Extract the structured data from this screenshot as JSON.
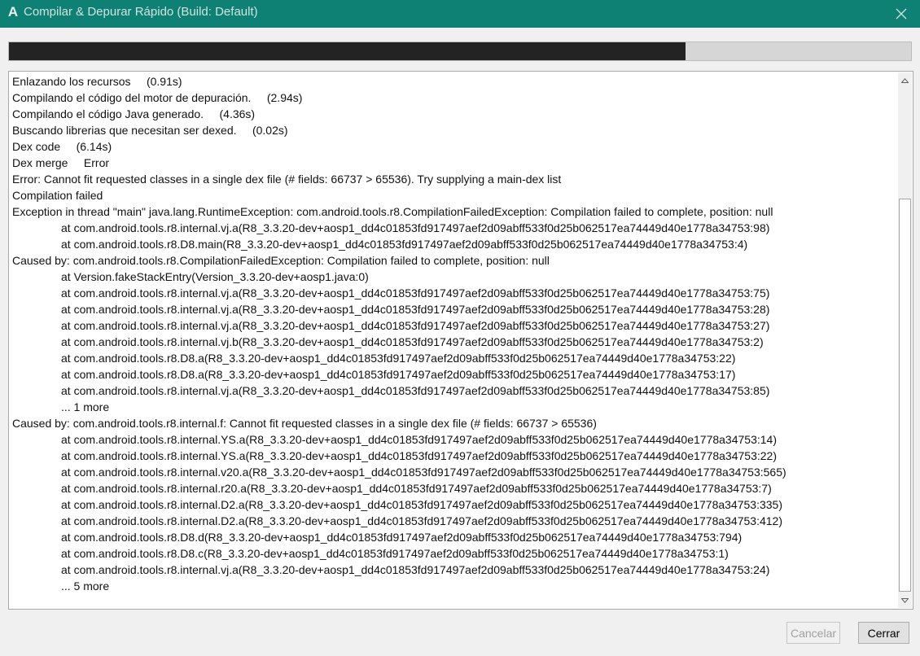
{
  "window": {
    "title": "Compilar & Depurar Rápido (Build: Default)",
    "app_icon_glyph": "A",
    "titlebar_color": "#0f8074",
    "close_icon": "close-icon"
  },
  "progress": {
    "value": 0.75
  },
  "log": {
    "lines": [
      {
        "text": "Enlazando los recursos     (0.91s)",
        "indent": false
      },
      {
        "text": "Compilando el código del motor de depuración.     (2.94s)",
        "indent": false
      },
      {
        "text": "Compilando el código Java generado.     (4.36s)",
        "indent": false
      },
      {
        "text": "Buscando librerias que necesitan ser dexed.     (0.02s)",
        "indent": false
      },
      {
        "text": "Dex code     (6.14s)",
        "indent": false
      },
      {
        "text": "Dex merge     Error",
        "indent": false
      },
      {
        "text": "Error: Cannot fit requested classes in a single dex file (# fields: 66737 > 65536). Try supplying a main-dex list",
        "indent": false
      },
      {
        "text": "Compilation failed",
        "indent": false
      },
      {
        "text": "Exception in thread \"main\" java.lang.RuntimeException: com.android.tools.r8.CompilationFailedException: Compilation failed to complete, position: null",
        "indent": false
      },
      {
        "text": "at com.android.tools.r8.internal.vj.a(R8_3.3.20-dev+aosp1_dd4c01853fd917497aef2d09abff533f0d25b062517ea74449d40e1778a34753:98)",
        "indent": true
      },
      {
        "text": "at com.android.tools.r8.D8.main(R8_3.3.20-dev+aosp1_dd4c01853fd917497aef2d09abff533f0d25b062517ea74449d40e1778a34753:4)",
        "indent": true
      },
      {
        "text": "Caused by: com.android.tools.r8.CompilationFailedException: Compilation failed to complete, position: null",
        "indent": false
      },
      {
        "text": "at Version.fakeStackEntry(Version_3.3.20-dev+aosp1.java:0)",
        "indent": true
      },
      {
        "text": "at com.android.tools.r8.internal.vj.a(R8_3.3.20-dev+aosp1_dd4c01853fd917497aef2d09abff533f0d25b062517ea74449d40e1778a34753:75)",
        "indent": true
      },
      {
        "text": "at com.android.tools.r8.internal.vj.a(R8_3.3.20-dev+aosp1_dd4c01853fd917497aef2d09abff533f0d25b062517ea74449d40e1778a34753:28)",
        "indent": true
      },
      {
        "text": "at com.android.tools.r8.internal.vj.a(R8_3.3.20-dev+aosp1_dd4c01853fd917497aef2d09abff533f0d25b062517ea74449d40e1778a34753:27)",
        "indent": true
      },
      {
        "text": "at com.android.tools.r8.internal.vj.b(R8_3.3.20-dev+aosp1_dd4c01853fd917497aef2d09abff533f0d25b062517ea74449d40e1778a34753:2)",
        "indent": true
      },
      {
        "text": "at com.android.tools.r8.D8.a(R8_3.3.20-dev+aosp1_dd4c01853fd917497aef2d09abff533f0d25b062517ea74449d40e1778a34753:22)",
        "indent": true
      },
      {
        "text": "at com.android.tools.r8.D8.a(R8_3.3.20-dev+aosp1_dd4c01853fd917497aef2d09abff533f0d25b062517ea74449d40e1778a34753:17)",
        "indent": true
      },
      {
        "text": "at com.android.tools.r8.internal.vj.a(R8_3.3.20-dev+aosp1_dd4c01853fd917497aef2d09abff533f0d25b062517ea74449d40e1778a34753:85)",
        "indent": true
      },
      {
        "text": "... 1 more",
        "indent": true
      },
      {
        "text": "Caused by: com.android.tools.r8.internal.f: Cannot fit requested classes in a single dex file (# fields: 66737 > 65536)",
        "indent": false
      },
      {
        "text": "at com.android.tools.r8.internal.YS.a(R8_3.3.20-dev+aosp1_dd4c01853fd917497aef2d09abff533f0d25b062517ea74449d40e1778a34753:14)",
        "indent": true
      },
      {
        "text": "at com.android.tools.r8.internal.YS.a(R8_3.3.20-dev+aosp1_dd4c01853fd917497aef2d09abff533f0d25b062517ea74449d40e1778a34753:22)",
        "indent": true
      },
      {
        "text": "at com.android.tools.r8.internal.v20.a(R8_3.3.20-dev+aosp1_dd4c01853fd917497aef2d09abff533f0d25b062517ea74449d40e1778a34753:565)",
        "indent": true
      },
      {
        "text": "at com.android.tools.r8.internal.r20.a(R8_3.3.20-dev+aosp1_dd4c01853fd917497aef2d09abff533f0d25b062517ea74449d40e1778a34753:7)",
        "indent": true
      },
      {
        "text": "at com.android.tools.r8.internal.D2.a(R8_3.3.20-dev+aosp1_dd4c01853fd917497aef2d09abff533f0d25b062517ea74449d40e1778a34753:335)",
        "indent": true
      },
      {
        "text": "at com.android.tools.r8.internal.D2.a(R8_3.3.20-dev+aosp1_dd4c01853fd917497aef2d09abff533f0d25b062517ea74449d40e1778a34753:412)",
        "indent": true
      },
      {
        "text": "at com.android.tools.r8.D8.d(R8_3.3.20-dev+aosp1_dd4c01853fd917497aef2d09abff533f0d25b062517ea74449d40e1778a34753:794)",
        "indent": true
      },
      {
        "text": "at com.android.tools.r8.D8.c(R8_3.3.20-dev+aosp1_dd4c01853fd917497aef2d09abff533f0d25b062517ea74449d40e1778a34753:1)",
        "indent": true
      },
      {
        "text": "at com.android.tools.r8.internal.vj.a(R8_3.3.20-dev+aosp1_dd4c01853fd917497aef2d09abff533f0d25b062517ea74449d40e1778a34753:24)",
        "indent": true
      },
      {
        "text": "... 5 more",
        "indent": true
      }
    ]
  },
  "buttons": {
    "cancel_label": "Cancelar",
    "cancel_enabled": false,
    "close_label": "Cerrar"
  }
}
